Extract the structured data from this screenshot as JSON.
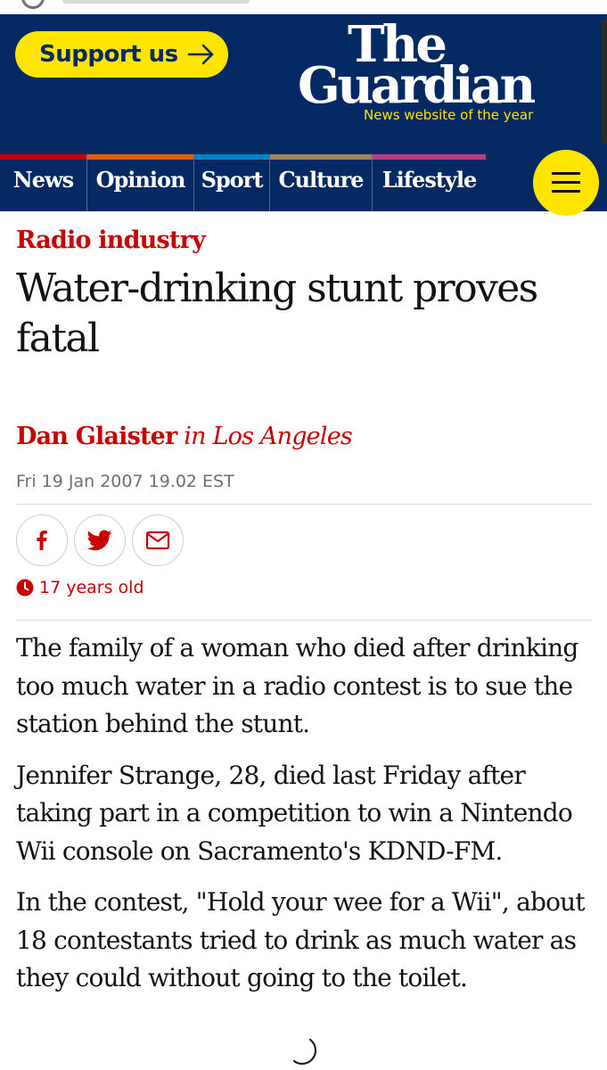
{
  "header": {
    "support_label": "Support us",
    "logo": {
      "line1": "The",
      "line2": "Guardian",
      "tagline": "News website of the year"
    },
    "colors": {
      "brand": "#052962",
      "accent": "#ffe500"
    }
  },
  "nav": {
    "items": [
      {
        "label": "News",
        "color": "#c70000"
      },
      {
        "label": "Opinion",
        "color": "#e05e00"
      },
      {
        "label": "Sport",
        "color": "#0084c6"
      },
      {
        "label": "Culture",
        "color": "#a1845c"
      },
      {
        "label": "Lifestyle",
        "color": "#bb3b80"
      }
    ],
    "menu_icon": "hamburger-menu-icon"
  },
  "article": {
    "kicker": "Radio industry",
    "headline": "Water-drinking stunt proves fatal",
    "byline": {
      "author": "Dan Glaister",
      "location": "in Los Angeles"
    },
    "dateline": "Fri 19 Jan 2007 19.02 EST",
    "share": {
      "icons": [
        "facebook-icon",
        "twitter-icon",
        "email-icon"
      ]
    },
    "age_label": "17 years old",
    "paragraphs": [
      "The family of a woman who died after drinking too much water in a radio contest is to sue the station behind the stunt.",
      "Jennifer Strange, 28, died last Friday after taking part in a competition to win a Nintendo Wii console on Sacramento's KDND-FM.",
      "In the contest, \"Hold your wee for a Wii\", about 18 contestants tried to drink as much water as they could without going to the toilet."
    ]
  }
}
